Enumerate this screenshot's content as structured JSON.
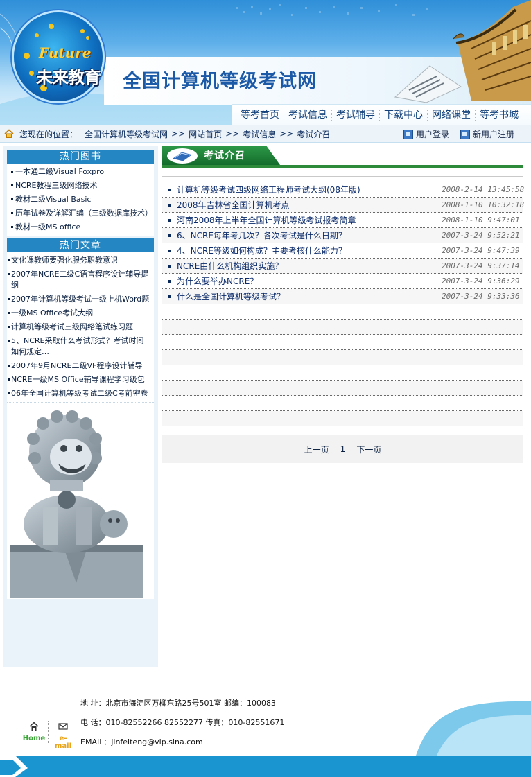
{
  "header": {
    "logo_en": "Future",
    "logo_cn": "未来教育",
    "site_title": "全国计算机等级考试网"
  },
  "nav": [
    "等考首页",
    "考试信息",
    "考试辅导",
    "下载中心",
    "网络课堂",
    "等考书城"
  ],
  "breadcrumb": {
    "prefix": "您现在的位置：",
    "items": [
      "全国计算机等级考试网",
      "网站首页",
      "考试信息",
      "考试介召"
    ],
    "sep": ">>"
  },
  "user_links": [
    "用户登录",
    "新用户注册"
  ],
  "sidebar": {
    "hot_books_title": "热门图书",
    "hot_books": [
      "一本通二级Visual Foxpro",
      "NCRE教程三级网络技术",
      "教材二级Visual Basic",
      "历年试卷及详解汇编（三级数据库技术）",
      "教材一级MS office"
    ],
    "hot_articles_title": "热门文章",
    "hot_articles": [
      "文化课教师要强化服务职教意识",
      "2007年NCRE二级C语言程序设计辅导提纲",
      "2007年计算机等级考试一级上机Word题",
      "一级MS Office考试大纲",
      "计算机等级考试三级网络笔试练习题",
      "5、NCRE采取什么考试形式？考试时间如何规定…",
      "2007年9月NCRE二级VF程序设计辅导",
      "NCRE一级MS Office辅导课程学习级包",
      "06年全国计算机等级考试二级C考前密卷"
    ]
  },
  "section": {
    "title": "考试介召"
  },
  "articles": [
    {
      "title": "计算机等级考试四级网络工程师考试大纲(08年版)",
      "date": "2008-2-14 13:45:58"
    },
    {
      "title": "2008年吉林省全国计算机考点",
      "date": "2008-1-10 10:32:18"
    },
    {
      "title": "河南2008年上半年全国计算机等级考试报考简章",
      "date": "2008-1-10 9:47:01"
    },
    {
      "title": "6、NCRE每年考几次？各次考试是什么日期？",
      "date": "2007-3-24 9:52:21"
    },
    {
      "title": "4、NCRE等级如何构成？主要考核什么能力？",
      "date": "2007-3-24 9:47:39"
    },
    {
      "title": "NCRE由什么机构组织实施？",
      "date": "2007-3-24 9:37:14"
    },
    {
      "title": "为什么要举办NCRE？",
      "date": "2007-3-24 9:36:29"
    },
    {
      "title": "什么是全国计算机等级考试？",
      "date": "2007-3-24 9:33:36"
    }
  ],
  "pager": {
    "prev": "上一页",
    "page": "1",
    "next": "下一页"
  },
  "footer": {
    "address": "地 址：北京市海淀区万柳东路25号501室  邮编：100083",
    "phone": "电 话：010-82552266 82552277 传真：010-82551671",
    "email": "EMAIL：jinfeiteng@vip.sina.com",
    "home_label": "Home",
    "mail_label": "e-mail"
  },
  "icons": {
    "home": "home-icon",
    "mail": "mail-icon",
    "user": "user-icon"
  },
  "colors": {
    "accent_blue": "#2487c4",
    "section_green": "#2d8a3a",
    "title_blue": "#1c5aa8"
  }
}
